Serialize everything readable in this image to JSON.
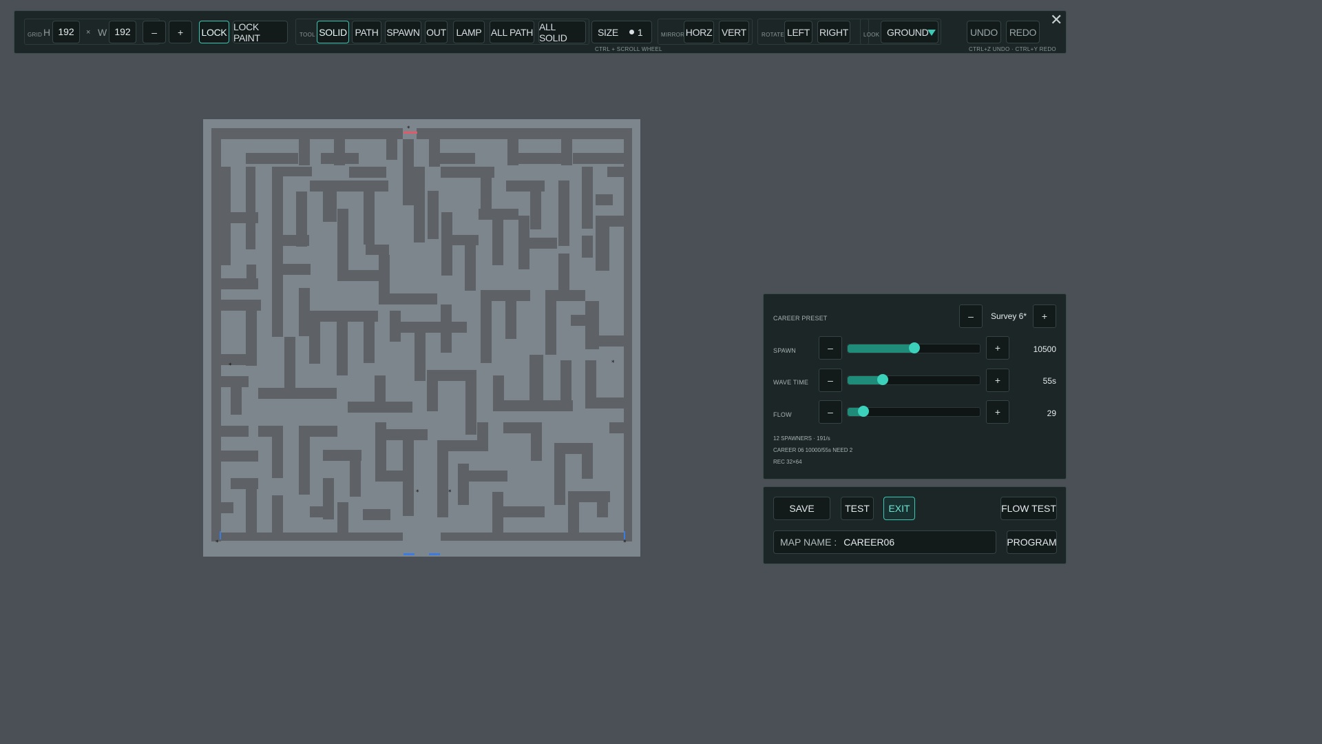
{
  "toolbar": {
    "grid": {
      "label": "GRID",
      "h_label": "H",
      "h_value": "192",
      "times": "×",
      "w_label": "W",
      "w_value": "192",
      "minus": "–",
      "plus": "+"
    },
    "lock": "LOCK",
    "lock_paint": "LOCK PAINT",
    "tool": {
      "label": "TOOL",
      "items": [
        "SOLID",
        "PATH",
        "SPAWN",
        "OUT",
        "LAMP",
        "ALL PATH",
        "ALL SOLID"
      ],
      "active": "SOLID"
    },
    "size": {
      "label": "SIZE",
      "value": "1",
      "hint": "CTRL + SCROLL WHEEL"
    },
    "mirror": {
      "label": "MIRROR",
      "horz": "HORZ",
      "vert": "VERT"
    },
    "rotate": {
      "label": "ROTATE",
      "left": "LEFT",
      "right": "RIGHT"
    },
    "look": {
      "label": "LOOK",
      "value": "GROUND"
    },
    "undo": "UNDO",
    "redo": "REDO",
    "undo_hint": "CTRL+Z UNDO · CTRL+Y REDO",
    "close": "✕"
  },
  "career": {
    "preset_label": "CAREER PRESET",
    "preset_value": "Survey 6*",
    "minus": "–",
    "plus": "+",
    "sliders": [
      {
        "label": "SPAWN",
        "value": "10500",
        "fraction": 0.5
      },
      {
        "label": "WAVE TIME",
        "value": "55s",
        "fraction": 0.26
      },
      {
        "label": "FLOW",
        "value": "29",
        "fraction": 0.12
      }
    ],
    "info": [
      "12 SPAWNERS · 191/s",
      "CAREER 06  10000/55s  NEED 2",
      "REC 32×64"
    ]
  },
  "actions": {
    "save": "SAVE",
    "test": "TEST",
    "exit": "EXIT",
    "flow_test": "FLOW TEST",
    "map_name_label": "MAP NAME :",
    "map_name_value": "CAREER06",
    "program": "PROGRAM"
  },
  "colors": {
    "accent": "#3cc8b4",
    "maze_wall": "#5e6266",
    "maze_floor": "#7e868d",
    "spawn_marker": "#e05a6a",
    "exit_marker": "#3c7ce0"
  }
}
